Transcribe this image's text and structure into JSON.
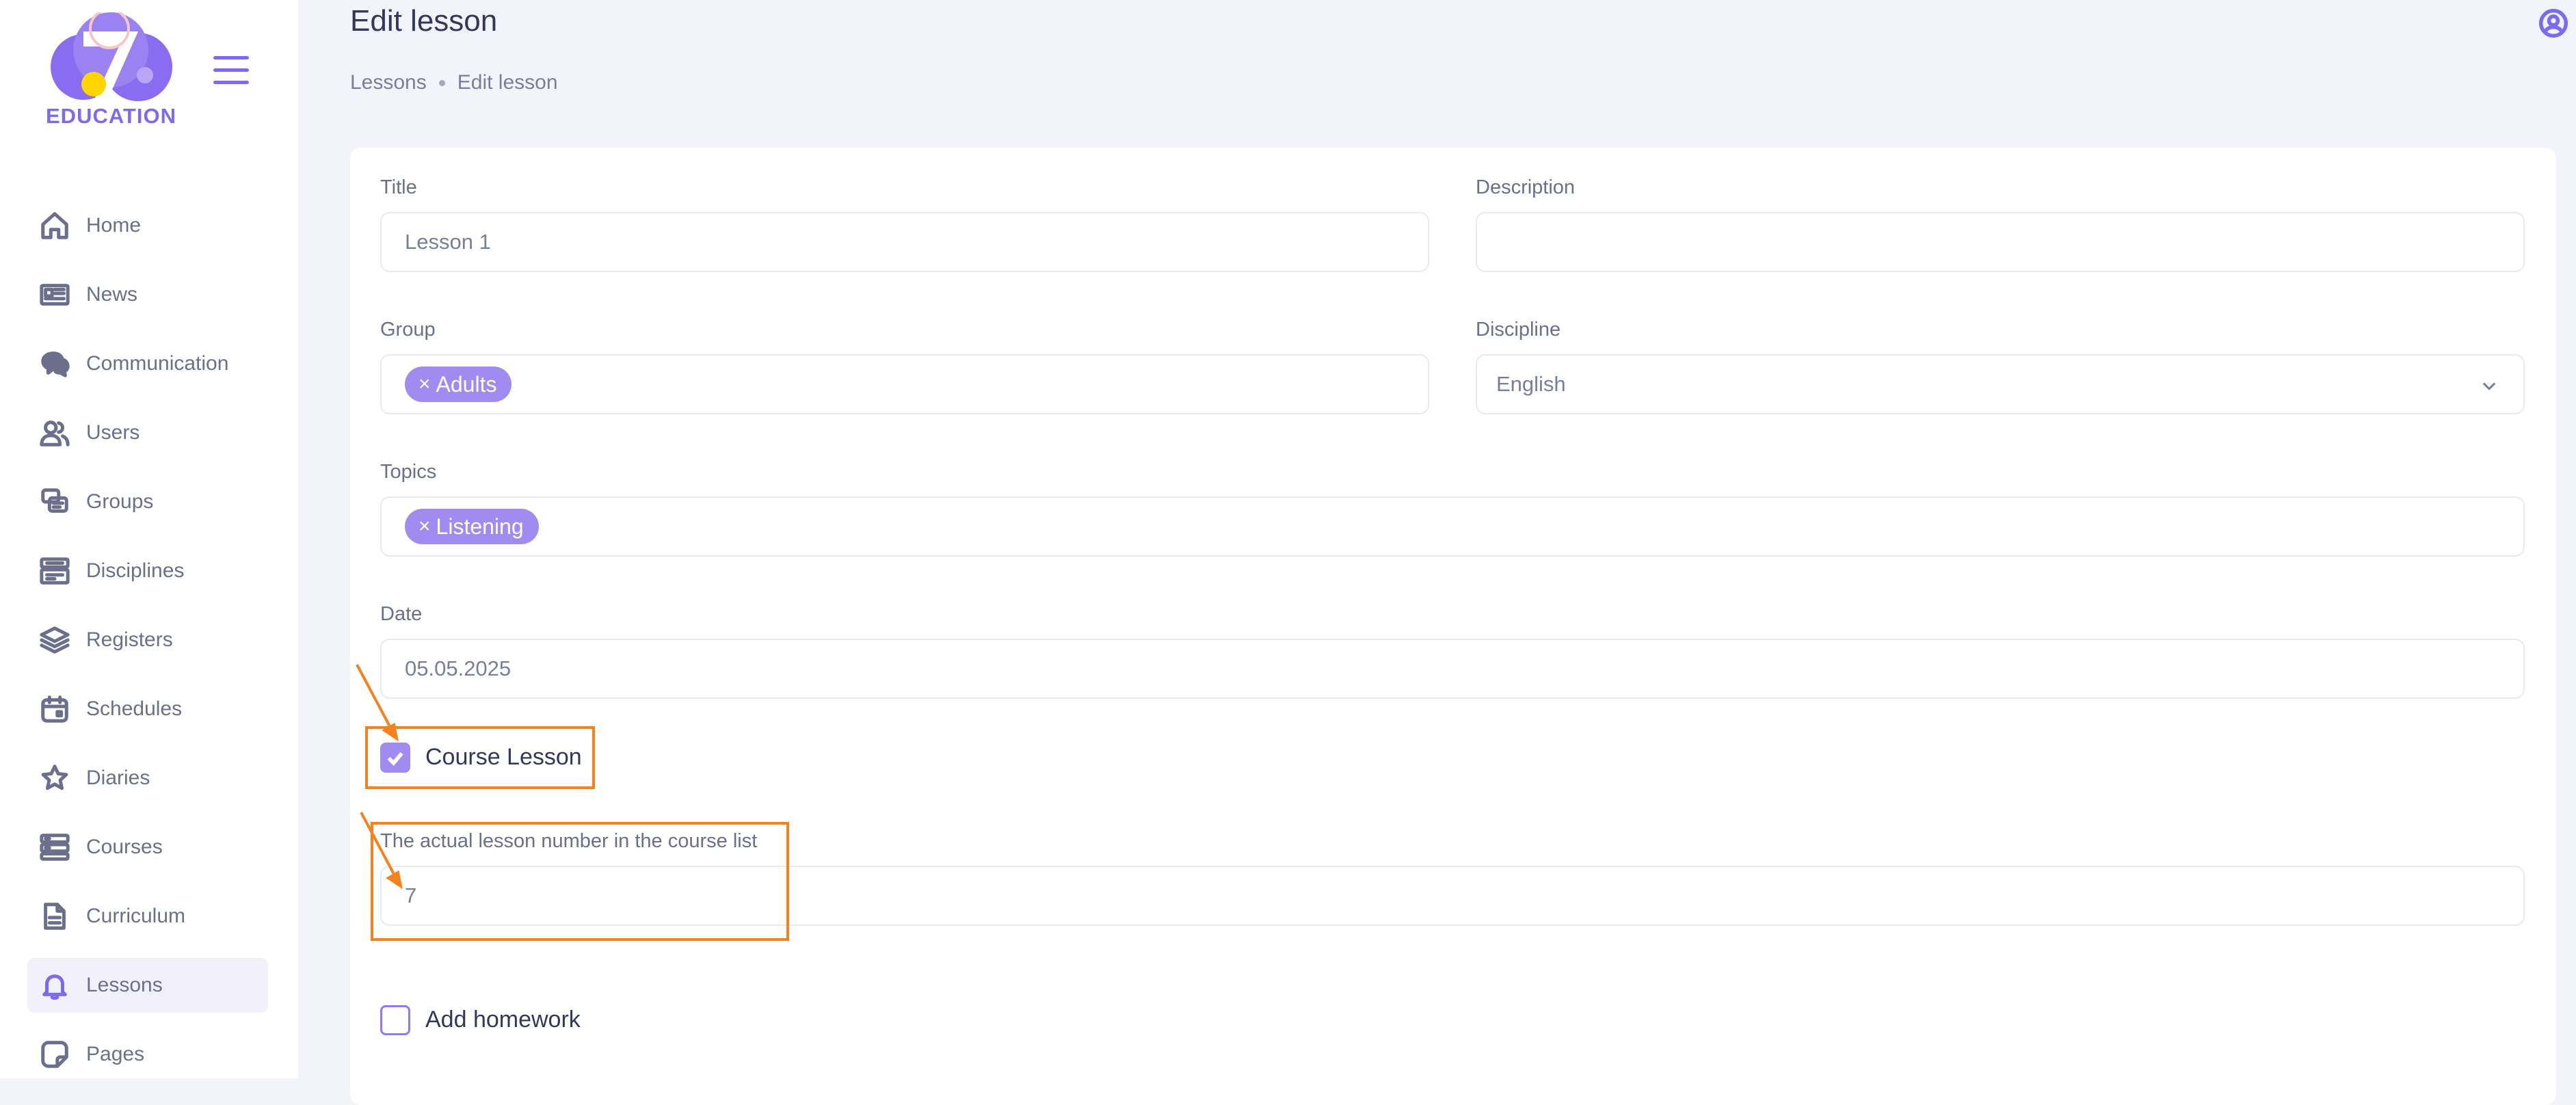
{
  "brand": {
    "logo_text": "EDUCATION",
    "logo_digit": "7",
    "accent_color": "#7c6bf0"
  },
  "sidebar": {
    "items": [
      {
        "label": "Home",
        "icon": "home-icon"
      },
      {
        "label": "News",
        "icon": "news-icon"
      },
      {
        "label": "Communication",
        "icon": "chat-icon"
      },
      {
        "label": "Users",
        "icon": "users-icon"
      },
      {
        "label": "Groups",
        "icon": "groups-icon"
      },
      {
        "label": "Disciplines",
        "icon": "disciplines-icon"
      },
      {
        "label": "Registers",
        "icon": "registers-icon"
      },
      {
        "label": "Schedules",
        "icon": "calendar-icon"
      },
      {
        "label": "Diaries",
        "icon": "star-icon"
      },
      {
        "label": "Courses",
        "icon": "courses-icon"
      },
      {
        "label": "Curriculum",
        "icon": "document-icon"
      },
      {
        "label": "Lessons",
        "icon": "bell-icon",
        "active": true
      },
      {
        "label": "Pages",
        "icon": "page-icon"
      }
    ]
  },
  "header": {
    "title": "Edit lesson",
    "breadcrumb": [
      "Lessons",
      "Edit lesson"
    ]
  },
  "form": {
    "title": {
      "label": "Title",
      "value": "Lesson 1"
    },
    "description": {
      "label": "Description",
      "value": ""
    },
    "group": {
      "label": "Group",
      "chips": [
        "Adults"
      ],
      "chip_remove": "×"
    },
    "discipline": {
      "label": "Discipline",
      "value": "English"
    },
    "topics": {
      "label": "Topics",
      "chips": [
        "Listening"
      ],
      "chip_remove": "×"
    },
    "date": {
      "label": "Date",
      "value": "05.05.2025"
    },
    "course_lesson": {
      "label": "Course Lesson",
      "checked": true
    },
    "lesson_number": {
      "label": "The actual lesson number in the course list",
      "value": "7"
    },
    "add_homework": {
      "label": "Add homework",
      "checked": false
    }
  },
  "annotation_color": "#f5821f"
}
